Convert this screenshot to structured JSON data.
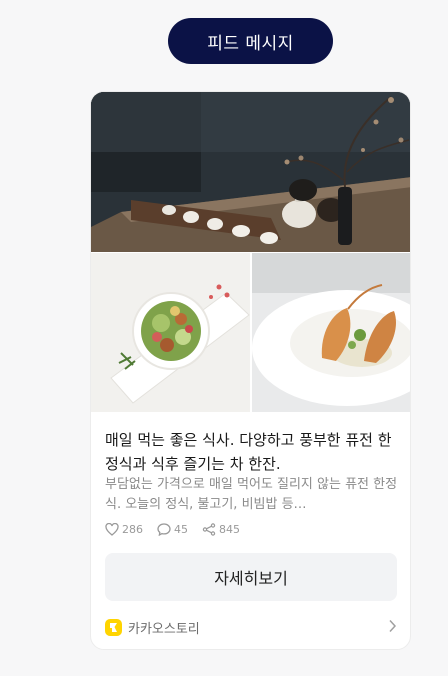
{
  "header": {
    "label": "피드 메시지"
  },
  "card": {
    "title": "매일 먹는 좋은 식사. 다양하고 풍부한 퓨전 한정식과 식후 즐기는 차 한잔.",
    "description": "부담없는 가격으로 매일 먹어도 질리지 않는 퓨전 한정식. 오늘의 정식, 불고기, 비빔밥 등…",
    "stats": {
      "likes": "286",
      "comments": "45",
      "shares": "845"
    },
    "button_label": "자세히보기",
    "footer": {
      "brand": "카카오스토리"
    }
  },
  "colors": {
    "pill": "#0b1246",
    "brand": "#ffd400"
  }
}
